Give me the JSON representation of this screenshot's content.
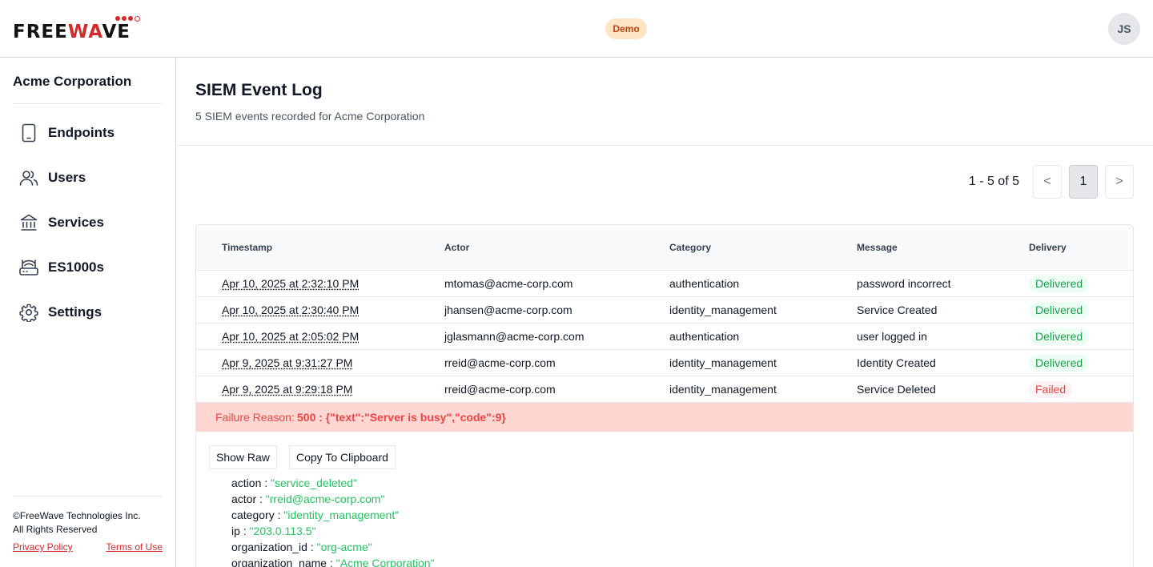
{
  "header": {
    "logo_prefix": "FREE",
    "logo_accent": "WA",
    "logo_suffix": "VE",
    "env_badge": "Demo",
    "avatar_initials": "JS"
  },
  "sidebar": {
    "org_name": "Acme Corporation",
    "items": [
      {
        "label": "Endpoints",
        "icon": "tablet-icon"
      },
      {
        "label": "Users",
        "icon": "users-icon"
      },
      {
        "label": "Services",
        "icon": "bank-icon"
      },
      {
        "label": "ES1000s",
        "icon": "router-icon"
      },
      {
        "label": "Settings",
        "icon": "gear-icon"
      }
    ],
    "copyright_line1": "©FreeWave Technologies Inc.",
    "copyright_line2": "All Rights Reserved",
    "privacy_label": "Privacy Policy",
    "terms_label": "Terms of Use"
  },
  "main": {
    "title": "SIEM Event Log",
    "subtitle": "5 SIEM events recorded for Acme Corporation",
    "pagination": {
      "range": "1 - 5 of 5",
      "prev": "<",
      "current": "1",
      "next": ">"
    },
    "columns": [
      "Timestamp",
      "Actor",
      "Category",
      "Message",
      "Delivery"
    ],
    "rows": [
      {
        "timestamp": "Apr 10, 2025 at 2:32:10 PM",
        "actor": "mtomas@acme-corp.com",
        "category": "authentication",
        "message": "password incorrect",
        "delivery": "Delivered"
      },
      {
        "timestamp": "Apr 10, 2025 at 2:30:40 PM",
        "actor": "jhansen@acme-corp.com",
        "category": "identity_management",
        "message": "Service Created",
        "delivery": "Delivered"
      },
      {
        "timestamp": "Apr 10, 2025 at 2:05:02 PM",
        "actor": "jglasmann@acme-corp.com",
        "category": "authentication",
        "message": "user logged in",
        "delivery": "Delivered"
      },
      {
        "timestamp": "Apr 9, 2025 at 9:31:27 PM",
        "actor": "rreid@acme-corp.com",
        "category": "identity_management",
        "message": "Identity Created",
        "delivery": "Delivered"
      },
      {
        "timestamp": "Apr 9, 2025 at 9:29:18 PM",
        "actor": "rreid@acme-corp.com",
        "category": "identity_management",
        "message": "Service Deleted",
        "delivery": "Failed"
      }
    ],
    "failure": {
      "label": "Failure Reason:",
      "value": "500 : {\"text\":\"Server is busy\",\"code\":9}"
    },
    "detail": {
      "show_raw_label": "Show Raw",
      "copy_label": "Copy To Clipboard",
      "fields": [
        {
          "key": "action",
          "value": "\"service_deleted\""
        },
        {
          "key": "actor",
          "value": "\"rreid@acme-corp.com\""
        },
        {
          "key": "category",
          "value": "\"identity_management\""
        },
        {
          "key": "ip",
          "value": "\"203.0.113.5\""
        },
        {
          "key": "organization_id",
          "value": "\"org-acme\""
        },
        {
          "key": "organization_name",
          "value": "\"Acme Corporation\""
        }
      ]
    }
  },
  "colors": {
    "brand_red": "#d42a2a",
    "delivered": "#16a34a",
    "failed": "#ef4444",
    "failure_banner": "#fed7d2",
    "json_value": "#22c55e"
  }
}
